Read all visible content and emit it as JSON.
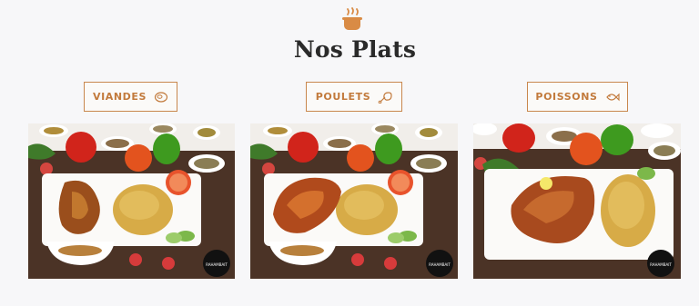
{
  "section": {
    "title": "Nos Plats",
    "icon": "cooking-pot-icon",
    "accent_color": "#c8874d"
  },
  "categories": [
    {
      "label": "VIANDES",
      "icon": "meat-icon"
    },
    {
      "label": "POULETS",
      "icon": "chicken-leg-icon"
    },
    {
      "label": "POISSONS",
      "icon": "fish-icon"
    }
  ],
  "dishes": [
    {
      "alt": "Plat de viande avec riz",
      "logo_text": "RAHAMBAIT"
    },
    {
      "alt": "Plat de poulet avec riz",
      "logo_text": "RAHAMBAIT"
    },
    {
      "alt": "Plat de poisson avec riz",
      "logo_text": "RAHAMBAIT"
    }
  ]
}
